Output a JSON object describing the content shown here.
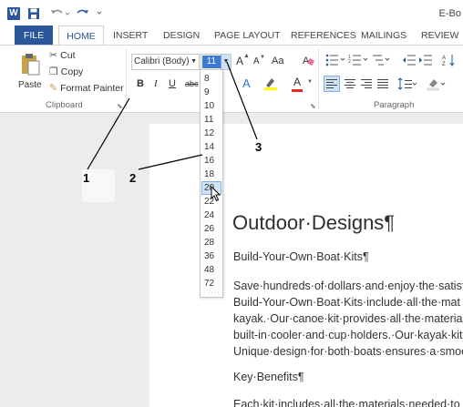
{
  "titlebar": {
    "app_icon_letter": "W",
    "title": "E-Bo"
  },
  "tabs": [
    {
      "label": "FILE"
    },
    {
      "label": "HOME"
    },
    {
      "label": "INSERT"
    },
    {
      "label": "DESIGN"
    },
    {
      "label": "PAGE LAYOUT"
    },
    {
      "label": "REFERENCES"
    },
    {
      "label": "MAILINGS"
    },
    {
      "label": "REVIEW"
    }
  ],
  "clipboard": {
    "paste_label": "Paste",
    "cut_label": "Cut",
    "copy_label": "Copy",
    "format_painter_label": "Format Painter",
    "group_label": "Clipboard"
  },
  "font": {
    "name": "Calibri (Body)",
    "size": "11",
    "bold": "B",
    "italic": "I",
    "underline": "U",
    "strike": "abc",
    "grow": "A",
    "shrink": "A",
    "case": "Aa",
    "effects": "A",
    "color": "A"
  },
  "paragraph": {
    "group_label": "Paragraph"
  },
  "font_size_dropdown": {
    "options": [
      "8",
      "9",
      "10",
      "11",
      "12",
      "14",
      "16",
      "18",
      "20",
      "22",
      "24",
      "26",
      "28",
      "36",
      "48",
      "72"
    ],
    "hovered": "20"
  },
  "document": {
    "heading": "Outdoor·Designs¶",
    "subtitle": "Build-Your-Own·Boat·Kits¶",
    "lines": [
      "Save·hundreds·of·dollars·and·enjoy·the·satisf",
      "Build-Your-Own·Boat·Kits·include·all·the·mat",
      "kayak.·Our·canoe·kit·provides·all·the·materia",
      "built-in·cooler·and·cup·holders.·Our·kayak·kit",
      "Unique·design·for·both·boats·ensures·a·smoo"
    ],
    "key_benefits": "Key·Benefits¶",
    "last_line": "Each·kit·includes·all·the·materials·needed·to"
  },
  "callouts": [
    "1",
    "2",
    "3"
  ],
  "colors": {
    "accent": "#2b579a",
    "highlight": "#3b7bd6",
    "hover_bg": "#cde3f7"
  }
}
